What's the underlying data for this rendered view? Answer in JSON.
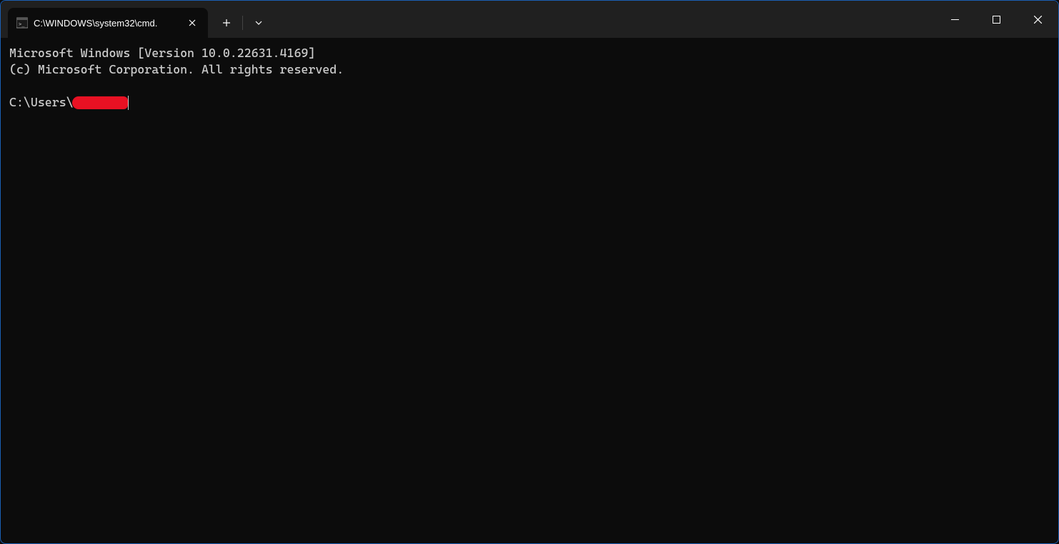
{
  "titlebar": {
    "tab": {
      "title": "C:\\WINDOWS\\system32\\cmd."
    }
  },
  "terminal": {
    "line1": "Microsoft Windows [Version 10.0.22631.4169]",
    "line2": "(c) Microsoft Corporation. All rights reserved.",
    "blank": "",
    "prompt_prefix": "C:\\Users\\"
  }
}
